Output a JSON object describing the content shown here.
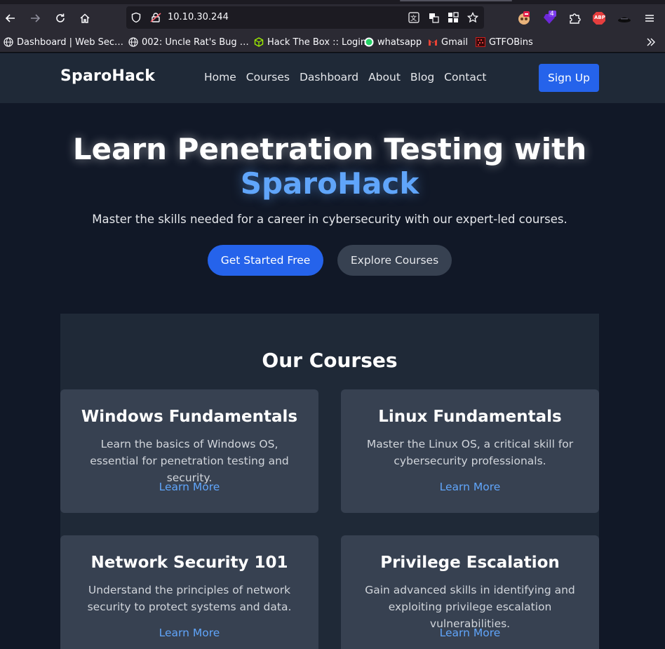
{
  "browser": {
    "url": "10.10.30.244",
    "extension_badge": "4",
    "bookmarks": [
      {
        "label": "Dashboard | Web Sec…",
        "icon": "globe-icon"
      },
      {
        "label": "002: Uncle Rat's Bug …",
        "icon": "globe-icon"
      },
      {
        "label": "Hack The Box :: Login",
        "icon": "htb-cube-icon"
      },
      {
        "label": "whatsapp",
        "icon": "whatsapp-icon"
      },
      {
        "label": "Gmail",
        "icon": "gmail-icon"
      },
      {
        "label": "GTFOBins",
        "icon": "gtfobins-icon"
      }
    ],
    "extensions": [
      "profile-avatar-icon",
      "purple-extension-icon",
      "puzzle-icon",
      "adblock-plus-icon",
      "hat-icon",
      "menu-icon"
    ],
    "adblock_label": "ABP"
  },
  "site": {
    "brand": "SparoHack",
    "nav": [
      "Home",
      "Courses",
      "Dashboard",
      "About",
      "Blog",
      "Contact"
    ],
    "signup": "Sign Up",
    "hero": {
      "title": "Learn Penetration Testing with",
      "brand": "SparoHack",
      "subtitle": "Master the skills needed for a career in cybersecurity with our expert-led courses.",
      "primary_cta": "Get Started Free",
      "secondary_cta": "Explore Courses"
    },
    "courses_section": {
      "title": "Our Courses",
      "items": [
        {
          "title": "Windows Fundamentals",
          "description": "Learn the basics of Windows OS, essential for penetration testing and security.",
          "link": "Learn More"
        },
        {
          "title": "Linux Fundamentals",
          "description": "Master the Linux OS, a critical skill for cybersecurity professionals.",
          "link": "Learn More"
        },
        {
          "title": "Network Security 101",
          "description": "Understand the principles of network security to protect systems and data.",
          "link": "Learn More"
        },
        {
          "title": "Privilege Escalation",
          "description": "Gain advanced skills in identifying and exploiting privilege escalation vulnerabilities.",
          "link": "Learn More"
        }
      ]
    }
  },
  "colors": {
    "accent": "#2563eb",
    "accent_light": "#60a5fa",
    "page_bg": "#111827",
    "panel_bg": "#1f2937",
    "card_bg": "#374151"
  }
}
